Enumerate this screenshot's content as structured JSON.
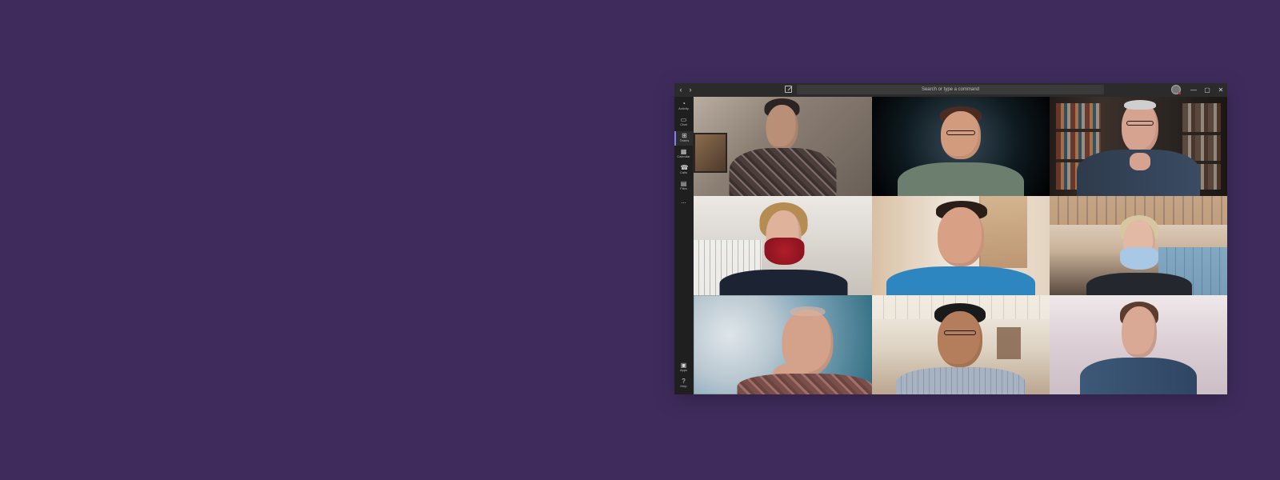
{
  "window": {
    "title": "",
    "search_placeholder": "Search or type a command"
  },
  "titlebar": {
    "controls": {
      "minimize": "—",
      "maximize": "▢",
      "close": "✕"
    }
  },
  "leftrail": {
    "items": [
      {
        "label": "Activity",
        "icon": "bell-icon"
      },
      {
        "label": "Chat",
        "icon": "chat-icon"
      },
      {
        "label": "Teams",
        "icon": "teams-icon",
        "active": true
      },
      {
        "label": "Calendar",
        "icon": "calendar-icon"
      },
      {
        "label": "Calls",
        "icon": "phone-icon"
      },
      {
        "label": "Files",
        "icon": "file-icon"
      }
    ],
    "more": "...",
    "bottom": [
      {
        "label": "Apps",
        "icon": "apps-icon"
      },
      {
        "label": "Help",
        "icon": "help-icon"
      }
    ]
  },
  "meeting": {
    "tiles": [
      {
        "name": ""
      },
      {
        "name": ""
      },
      {
        "name": ""
      },
      {
        "name": ""
      },
      {
        "name": ""
      },
      {
        "name": ""
      },
      {
        "name": ""
      },
      {
        "name": ""
      },
      {
        "name": ""
      }
    ]
  },
  "colors": {
    "background": "#3f2c5d",
    "teams_accent": "#7b83eb"
  }
}
